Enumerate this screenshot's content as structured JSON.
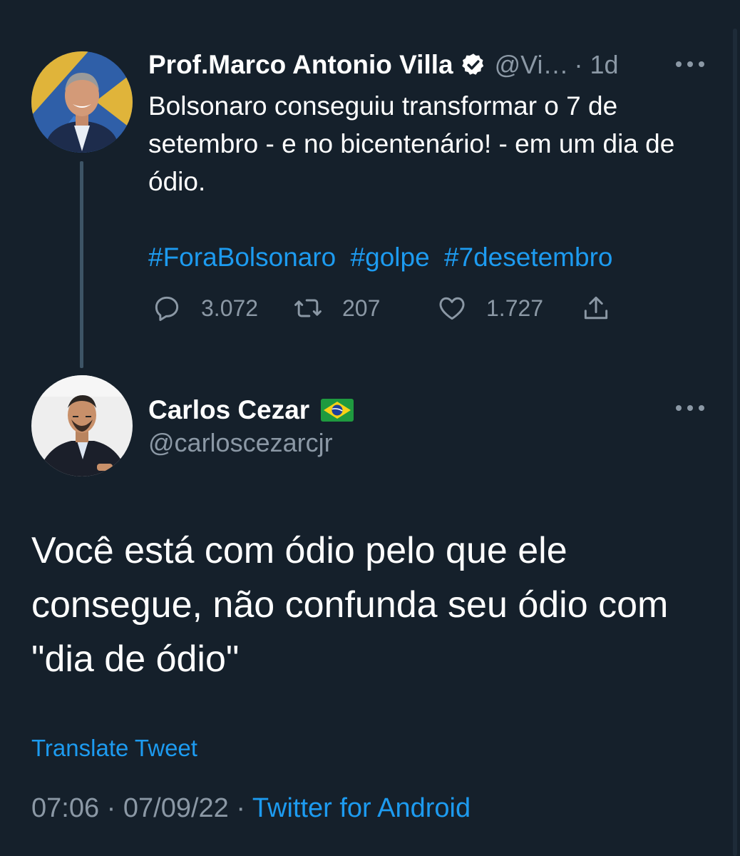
{
  "parent_tweet": {
    "author_name": "Prof.Marco Antonio Villa",
    "handle": "@Vi…",
    "time": "· 1d",
    "text": "Bolsonaro conseguiu transformar o 7 de setembro - e no bicentenário! - em um dia de ódio.",
    "hashtags": [
      "#ForaBolsonaro",
      "#golpe",
      "#7desetembro"
    ],
    "replies": "3.072",
    "retweets": "207",
    "likes": "1.727"
  },
  "reply_tweet": {
    "author_name": "Carlos Cezar",
    "handle": "@carloscezarcjr",
    "text": "Você está com ódio pelo que ele consegue, não confunda seu ódio com \"dia de ódio\"",
    "translate_label": "Translate Tweet",
    "time": "07:06",
    "date": "07/09/22",
    "separator": "·",
    "source": "Twitter for Android"
  },
  "colors": {
    "background": "#15202b",
    "accent": "#1d9bf0",
    "secondary_text": "#8b98a5"
  },
  "icons": [
    "verified-badge-icon",
    "more-icon",
    "reply-icon",
    "retweet-icon",
    "like-icon",
    "share-icon",
    "brazil-flag-icon"
  ]
}
